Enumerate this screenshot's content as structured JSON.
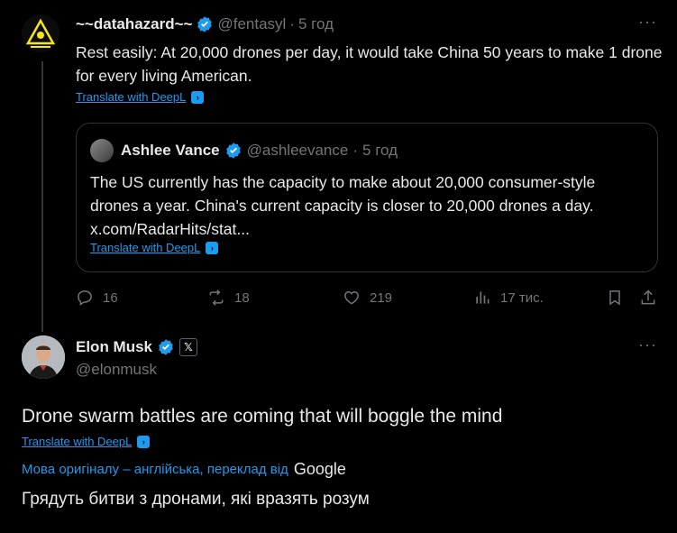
{
  "tweet1": {
    "display_name": "~~datahazard~~",
    "handle": "@fentasyl",
    "time": "5 год",
    "text": "Rest easily: At 20,000 drones per day, it would take China 50 years to make 1 drone for every living American.",
    "translate_label": "Translate with DeepL",
    "quote": {
      "display_name": "Ashlee Vance",
      "handle": "@ashleevance",
      "time": "5 год",
      "text": "The US currently has the capacity to make about 20,000 consumer-style drones a year. China's current capacity is closer to 20,000 drones a day. x.com/RadarHits/stat...",
      "translate_label": "Translate with DeepL"
    },
    "actions": {
      "replies": "16",
      "reposts": "18",
      "likes": "219",
      "views": "17 тис."
    }
  },
  "tweet2": {
    "display_name": "Elon Musk",
    "handle": "@elonmusk",
    "text": "Drone swarm battles are coming that will boggle the mind",
    "translate_label": "Translate with DeepL",
    "original_language_note": "Мова оригіналу – англійська, переклад від",
    "google_label": "Google",
    "translation": "Грядуть битви з дронами, які вразять розум"
  },
  "colors": {
    "background": "#000000",
    "text": "#e7e9ea",
    "muted": "#71767b",
    "accent": "#1d9bf0"
  }
}
